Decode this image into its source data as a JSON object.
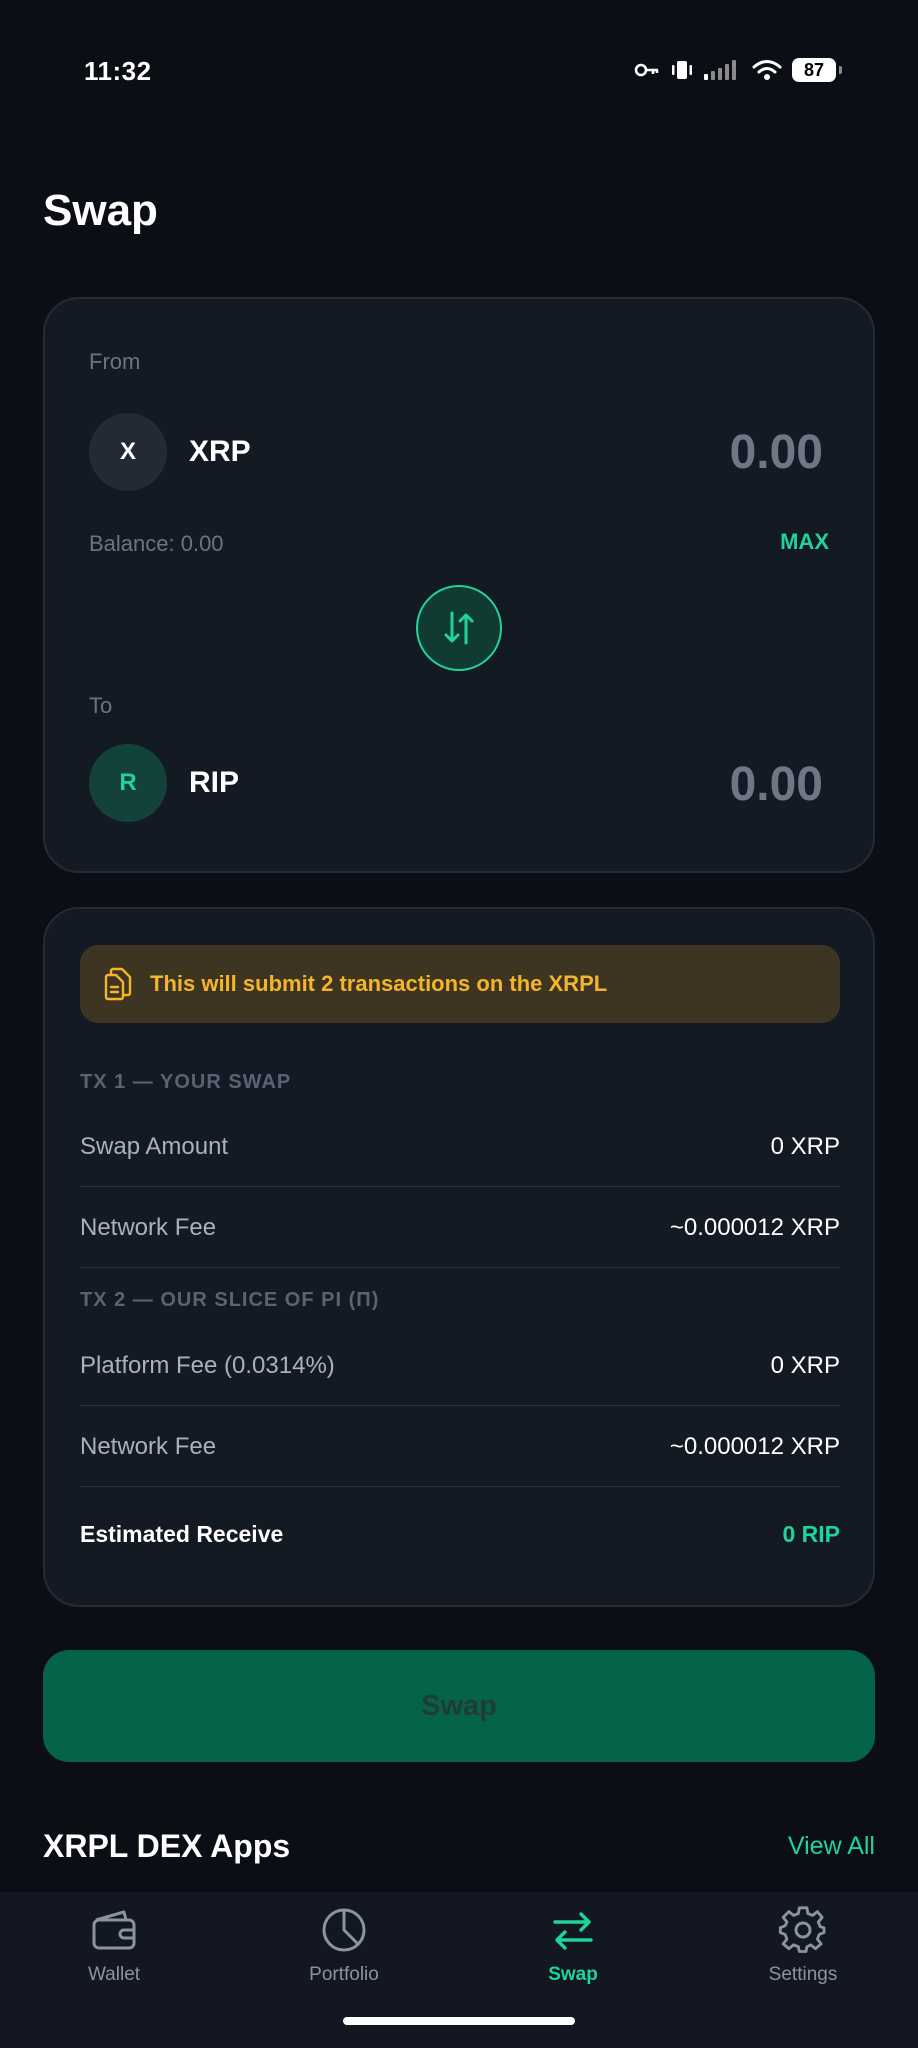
{
  "status_bar": {
    "time": "11:32",
    "battery": "87"
  },
  "page": {
    "title": "Swap"
  },
  "swap": {
    "from_label": "From",
    "from_token_initial": "X",
    "from_token_name": "XRP",
    "from_amount": "0.00",
    "balance": "Balance: 0.00",
    "max_label": "MAX",
    "to_label": "To",
    "to_token_initial": "R",
    "to_token_name": "RIP",
    "to_amount": "0.00"
  },
  "details": {
    "notice": "This will submit 2 transactions on the XRPL",
    "tx1_header": "TX 1 — YOUR SWAP",
    "tx1_rows": [
      {
        "label": "Swap Amount",
        "value": "0 XRP"
      },
      {
        "label": "Network Fee",
        "value": "~0.000012 XRP"
      }
    ],
    "tx2_header": "TX 2 — OUR SLICE OF PI (Π)",
    "tx2_rows": [
      {
        "label": "Platform Fee (0.0314%)",
        "value": "0 XRP"
      },
      {
        "label": "Network Fee",
        "value": "~0.000012 XRP"
      }
    ],
    "estimated_label": "Estimated Receive",
    "estimated_value": "0 RIP"
  },
  "actions": {
    "swap_button": "Swap"
  },
  "dex": {
    "title": "XRPL DEX Apps",
    "view_all": "View All"
  },
  "tabs": [
    {
      "label": "Wallet",
      "icon": "wallet-icon"
    },
    {
      "label": "Portfolio",
      "icon": "pie-chart-icon"
    },
    {
      "label": "Swap",
      "icon": "swap-arrows-icon",
      "active": true
    },
    {
      "label": "Settings",
      "icon": "gear-icon"
    }
  ],
  "colors": {
    "accent": "#1fd39a",
    "warning": "#f5b52a",
    "background": "#0b0e15",
    "card": "#141a24"
  }
}
